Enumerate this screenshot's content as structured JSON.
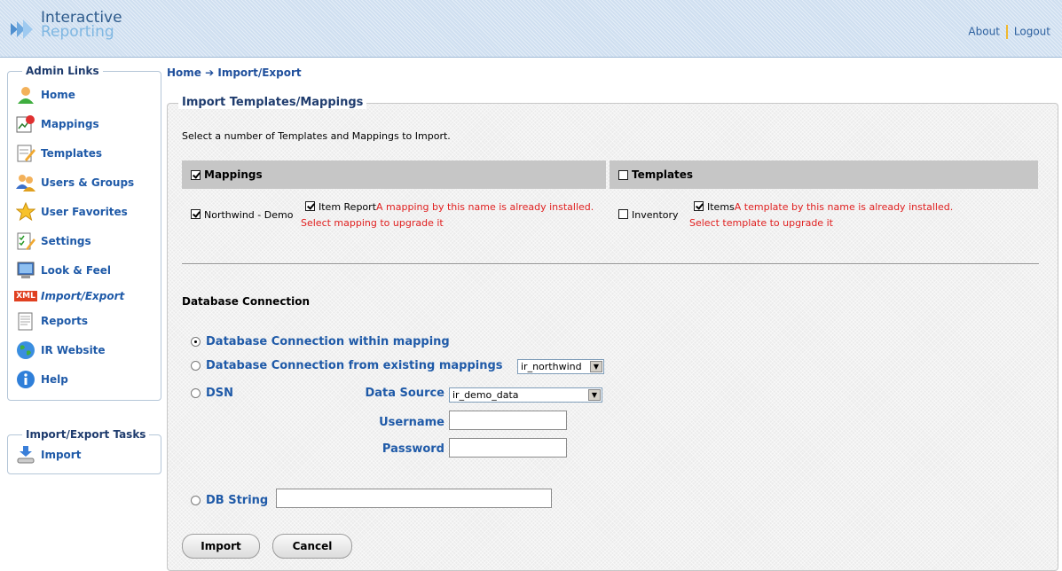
{
  "app": {
    "logo_line1": "Interactive",
    "logo_line2": "Reporting"
  },
  "top_nav": {
    "about": "About",
    "logout": "Logout"
  },
  "sidebar": {
    "title": "Admin Links",
    "items": [
      {
        "label": "Home",
        "icon": "user-icon"
      },
      {
        "label": "Mappings",
        "icon": "mappings-icon"
      },
      {
        "label": "Templates",
        "icon": "templates-icon"
      },
      {
        "label": "Users & Groups",
        "icon": "users-groups-icon"
      },
      {
        "label": "User Favorites",
        "icon": "star-icon"
      },
      {
        "label": "Settings",
        "icon": "settings-icon"
      },
      {
        "label": "Look & Feel",
        "icon": "monitor-icon"
      },
      {
        "label": "Import/Export",
        "icon": "xml-icon",
        "badge": "XML"
      },
      {
        "label": "Reports",
        "icon": "report-icon"
      },
      {
        "label": "IR Website",
        "icon": "globe-icon"
      },
      {
        "label": "Help",
        "icon": "info-icon"
      }
    ]
  },
  "tasks": {
    "title": "Import/Export Tasks",
    "items": [
      {
        "label": "Import",
        "icon": "import-icon"
      }
    ]
  },
  "breadcrumb": {
    "home": "Home",
    "arrow": "➔",
    "current": "Import/Export"
  },
  "main": {
    "title": "Import Templates/Mappings",
    "intro": "Select a number of Templates and Mappings to Import.",
    "mappings": {
      "header": "Mappings",
      "header_checked": true,
      "item1": "Northwind - Demo",
      "item2": "Item Report",
      "error1": "A mapping by this name is already installed.",
      "error2": "Select mapping to upgrade it"
    },
    "templates": {
      "header": "Templates",
      "header_checked": false,
      "item1": "Inventory",
      "item2": "Items",
      "error1": "A template by this name is already installed.",
      "error2": "Select template to upgrade it"
    },
    "db": {
      "title": "Database Connection",
      "opt_within": "Database Connection within mapping",
      "opt_existing": "Database Connection from existing mappings",
      "existing_value": "ir_northwind",
      "opt_dsn": "DSN",
      "data_source_label": "Data Source",
      "data_source_value": "ir_demo_data",
      "username_label": "Username",
      "password_label": "Password",
      "opt_dbstring": "DB String"
    },
    "buttons": {
      "import": "Import",
      "cancel": "Cancel"
    }
  },
  "colors": {
    "link": "#1f5aa8",
    "error": "#e02020",
    "header_band": "#c6c6c6"
  }
}
